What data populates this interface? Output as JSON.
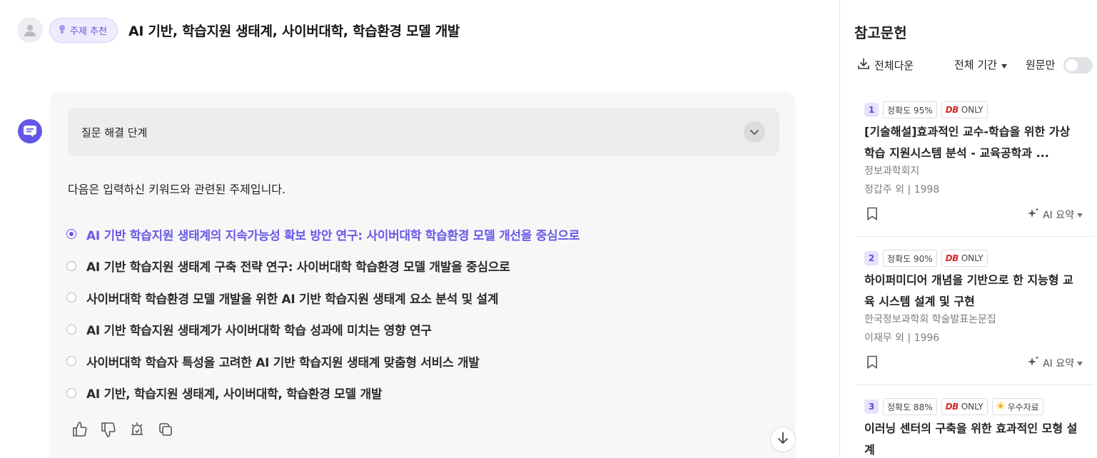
{
  "header": {
    "topic_badge": "주제 추천",
    "title": "AI 기반, 학습지원 생태계, 사이버대학, 학습환경 모델 개발"
  },
  "answer": {
    "steps_label": "질문 해결 단계",
    "intro": "다음은 입력하신 키워드와 관련된 주제입니다.",
    "topics": [
      "AI 기반 학습지원 생태계의 지속가능성 확보 방안 연구: 사이버대학 학습환경 모델 개선을 중심으로",
      "AI 기반 학습지원 생태계 구축 전략 연구: 사이버대학 학습환경 모델 개발을 중심으로",
      "사이버대학 학습환경 모델 개발을 위한 AI 기반 학습지원 생태계 요소 분석 및 설계",
      "AI 기반 학습지원 생태계가 사이버대학 학습 성과에 미치는 영향 연구",
      "사이버대학 학습자 특성을 고려한 AI 기반 학습지원 생태계 맞춤형 서비스 개발",
      "AI 기반, 학습지원 생태계, 사이버대학, 학습환경 모델 개발"
    ],
    "selected_index": 0
  },
  "sidebar": {
    "title": "참고문헌",
    "download_all": "전체다운",
    "period": "전체 기간",
    "original_only": "원문만",
    "original_only_on": false,
    "refs": [
      {
        "num": "1",
        "accuracy": "정확도 95%",
        "db_logo": "DB",
        "db_only": "ONLY",
        "title": "[기술해설]효과적인 교수-학습을 위한 가상학습 지원시스템 분석 - 교육공학과 ...",
        "journal": "정보과학회지",
        "meta": "정갑주 외 | 1998",
        "ai_summary": "AI 요약"
      },
      {
        "num": "2",
        "accuracy": "정확도 90%",
        "db_logo": "DB",
        "db_only": "ONLY",
        "title": "하이퍼미디어 개념을 기반으로 한 지능형 교육 시스템 설계 및 구현",
        "journal": "한국정보과학회 학술발표논문집",
        "meta": "이재무 외 | 1996",
        "ai_summary": "AI 요약"
      },
      {
        "num": "3",
        "accuracy": "정확도 88%",
        "db_logo": "DB",
        "db_only": "ONLY",
        "excellent": "우수자료",
        "title": "이러닝 센터의 구축을 위한 효과적인 모형 설계"
      }
    ]
  },
  "colors": {
    "accent": "#6a56e6",
    "db_red": "#d4282b"
  },
  "icons": [
    "user-avatar-icon",
    "lightbulb-icon",
    "chat-bot-icon",
    "chevron-down-icon",
    "thumbs-up-icon",
    "thumbs-down-icon",
    "report-icon",
    "copy-icon",
    "arrow-down-icon",
    "download-icon",
    "caret-down-icon",
    "bookmark-icon",
    "sparkle-icon",
    "sun-icon"
  ]
}
